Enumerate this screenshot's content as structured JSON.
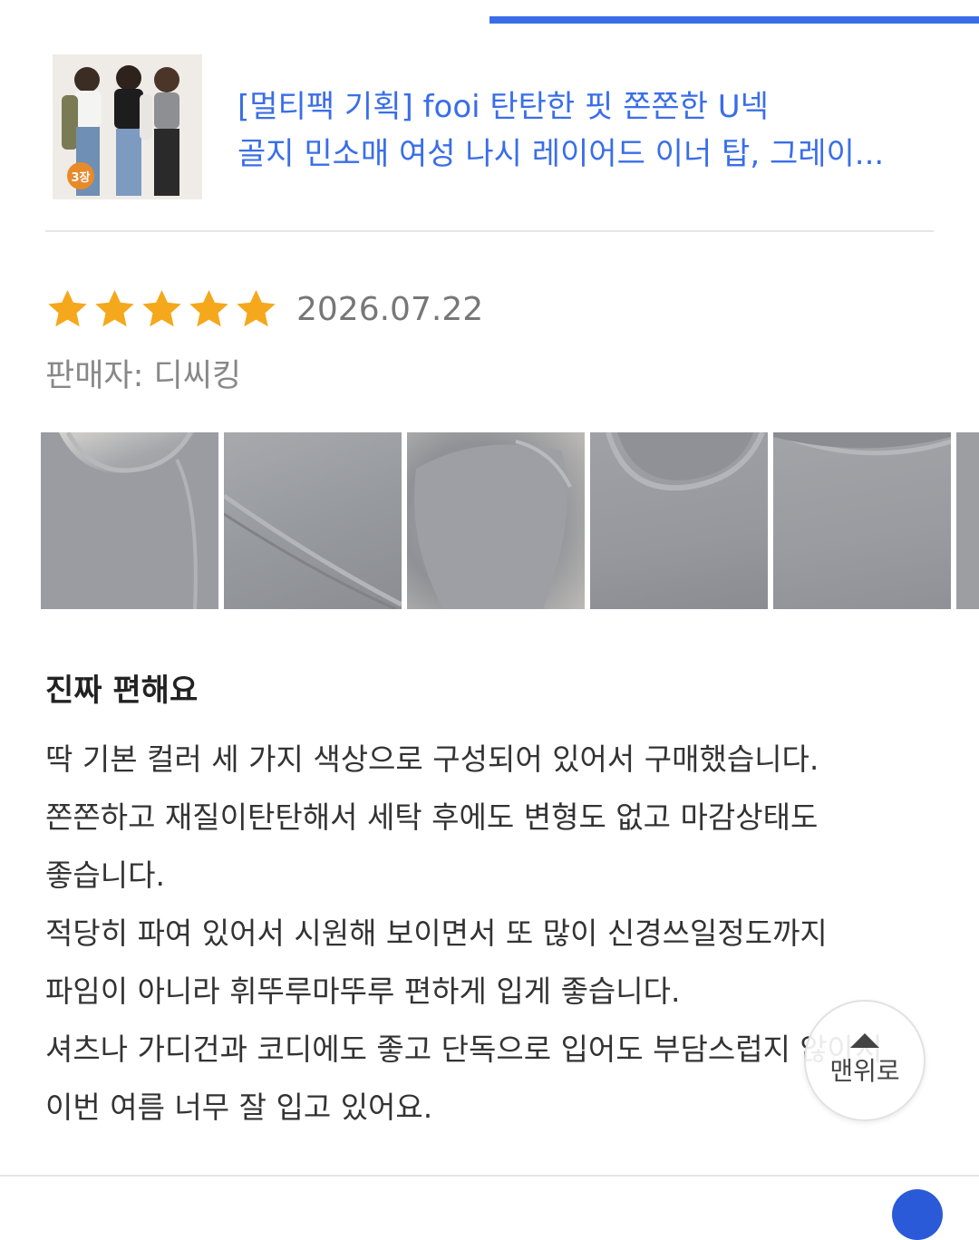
{
  "product": {
    "title_line1": "[멀티팩 기획] fooi 탄탄한 핏 쫀쫀한 U넥",
    "title_line2": "골지 민소매 여성 나시 레이어드 이너 탑, 그레이...",
    "badge": "3장"
  },
  "review": {
    "rating": 5,
    "rating_max": 5,
    "date": "2026.07.22",
    "seller": "판매자: 디씨킹",
    "title": "진짜 편해요",
    "body_lines": [
      "딱 기본 컬러 세 가지 색상으로 구성되어 있어서 구매했습니다.",
      "쫀쫀하고 재질이탄탄해서 세탁 후에도 변형도 없고 마감상태도",
      "좋습니다.",
      "적당히 파여 있어서 시원해 보이면서 또 많이 신경쓰일정도까지",
      "파임이 아니라 휘뚜루마뚜루 편하게 입게 좋습니다.",
      "셔츠나 가디건과 코디에도 좋고 단독으로 입어도 부담스럽지 않아서",
      "이번  여름 너무 잘 입고 있어요."
    ]
  },
  "scroll_top": {
    "label": "맨위로"
  },
  "colors": {
    "accent": "#3a6ee8",
    "star": "#f5a81c",
    "badge": "#e8892a"
  },
  "icons": {
    "star": "star-icon",
    "scroll_top": "caret-up-icon"
  }
}
